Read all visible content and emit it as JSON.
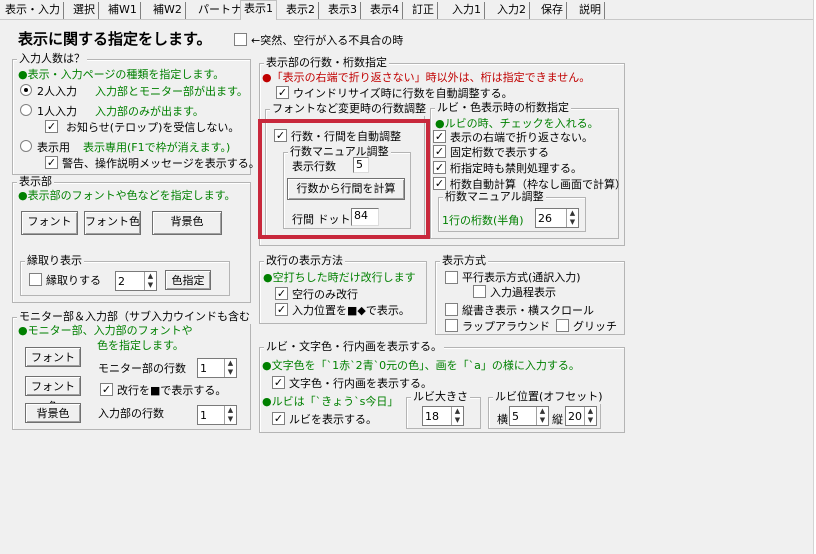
{
  "tabs": [
    "表示・入力",
    "選択",
    "補W1",
    "補W2",
    "パートナ",
    "表示1",
    "表示2",
    "表示3",
    "表示4",
    "訂正",
    "入力1",
    "入力2",
    "保存",
    "説明"
  ],
  "title": "表示に関する指定をします。",
  "glitch_note": "←突然、空行が入る不具合の時",
  "input_count": {
    "label": "入力人数は？",
    "desc": "●表示・入力ページの種類を指定します。",
    "opt2": "2人入力",
    "opt2_desc": "入力部とモニター部が出ます。",
    "opt1": "1人入力",
    "opt1_desc": "入力部のみが出ます。",
    "telop": "お知らせ(テロップ)を受信しない。",
    "opt_display": "表示用",
    "opt_display_desc": "表示専用(F1で枠が消えます。)",
    "warn": "警告、操作説明メッセージを表示する。"
  },
  "display": {
    "label": "表示部",
    "desc": "●表示部のフォントや色などを指定します。",
    "font_btn": "フォント",
    "color_btn": "フォント色",
    "bg_btn": "背景色"
  },
  "border": {
    "label": "縁取り表示",
    "check_label": "縁取りする",
    "value": "2",
    "color_btn": "色指定"
  },
  "monitor": {
    "label": "モニター部＆入力部（サブ入力ウインドも含む",
    "desc1": "●モニター部、入力部のフォントや",
    "desc2": "色を指定します。",
    "font_btn": "フォント",
    "color_btn": "フォント色",
    "bg_btn": "背景色",
    "mon_lines_label": "モニター部の行数",
    "mon_lines": "1",
    "newline_label": "改行を■で表示する。",
    "in_lines_label": "入力部の行数",
    "in_lines": "1"
  },
  "lines": {
    "label": "表示部の行数・桁数指定",
    "desc": "●「表示の右端で折り返さない」時以外は、桁は指定できません。",
    "window_resize": "ウインドリサイズ時に行数を自動調整する。"
  },
  "font_change": {
    "label": "フォントなど変更時の行数調整",
    "auto_label": "行数・行間を自動調整",
    "manual_label": "行数マニュアル調整",
    "rows_label": "表示行数",
    "rows_value": "5",
    "calc_btn": "行数から行間を計算",
    "gap_label": "行間 ドット",
    "gap_value": "84"
  },
  "ruby_cols": {
    "label": "ルビ・色表示時の桁数指定",
    "desc": "●ルビの時、チェックを入れる。",
    "no_wrap": "表示の右端で折り返さない。",
    "fixed": "固定桁数で表示する",
    "kinsoku": "桁指定時も禁則処理する。",
    "auto_calc": "桁数自動計算（枠なし画面で計算）",
    "manual_label": "桁数マニュアル調整",
    "per_line_label": "1行の桁数(半角)",
    "per_line_value": "26"
  },
  "newline": {
    "label": "改行の表示方法",
    "desc": "●空打ちした時だけ改行します",
    "empty_only": "空行のみ改行",
    "marker": "入力位置を■◆で表示。"
  },
  "display_mode": {
    "label": "表示方式",
    "parallel": "平行表示方式(通訳入力)",
    "process": "入力過程表示",
    "vertical": "縦書き表示・横スクロール",
    "wrap": "ラップアラウンド",
    "glitch": "グリッチ"
  },
  "ruby": {
    "label": "ルビ・文字色・行内画を表示する。",
    "desc": "●文字色を「`1赤`2青`0元の色」、画を「`a」の様に入力する。",
    "color_check": "文字色・行内画を表示する。",
    "ruby_desc": "●ルビは「`きょう`s今日」",
    "ruby_check": "ルビを表示する。",
    "size_label": "ルビ大きさ",
    "size_value": "18",
    "offset_label": "ルビ位置(オフセット)",
    "x_label": "横",
    "x_value": "5",
    "y_label": "縦",
    "y_value": "20"
  }
}
